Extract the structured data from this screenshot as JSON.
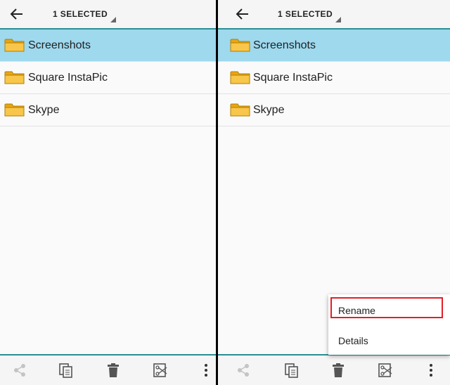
{
  "panels": [
    {
      "selection_label": "1 SELECTED",
      "items": [
        {
          "name": "Screenshots",
          "selected": true
        },
        {
          "name": "Square InstaPic",
          "selected": false
        },
        {
          "name": "Skype",
          "selected": false
        }
      ]
    },
    {
      "selection_label": "1 SELECTED",
      "items": [
        {
          "name": "Screenshots",
          "selected": true
        },
        {
          "name": "Square InstaPic",
          "selected": false
        },
        {
          "name": "Skype",
          "selected": false
        }
      ]
    }
  ],
  "context_menu": {
    "items": [
      "Rename",
      "Details"
    ],
    "highlighted": "Rename"
  },
  "icons": [
    "back-arrow-icon",
    "dropdown-triangle-icon",
    "folder-icon",
    "share-icon",
    "copy-icon",
    "delete-icon",
    "cut-icon",
    "more-icon"
  ],
  "colors": {
    "accent": "#2a8f93",
    "selected_row": "#9ed9ee",
    "highlight_box": "#e21f26",
    "folder": "#f5b91b"
  }
}
